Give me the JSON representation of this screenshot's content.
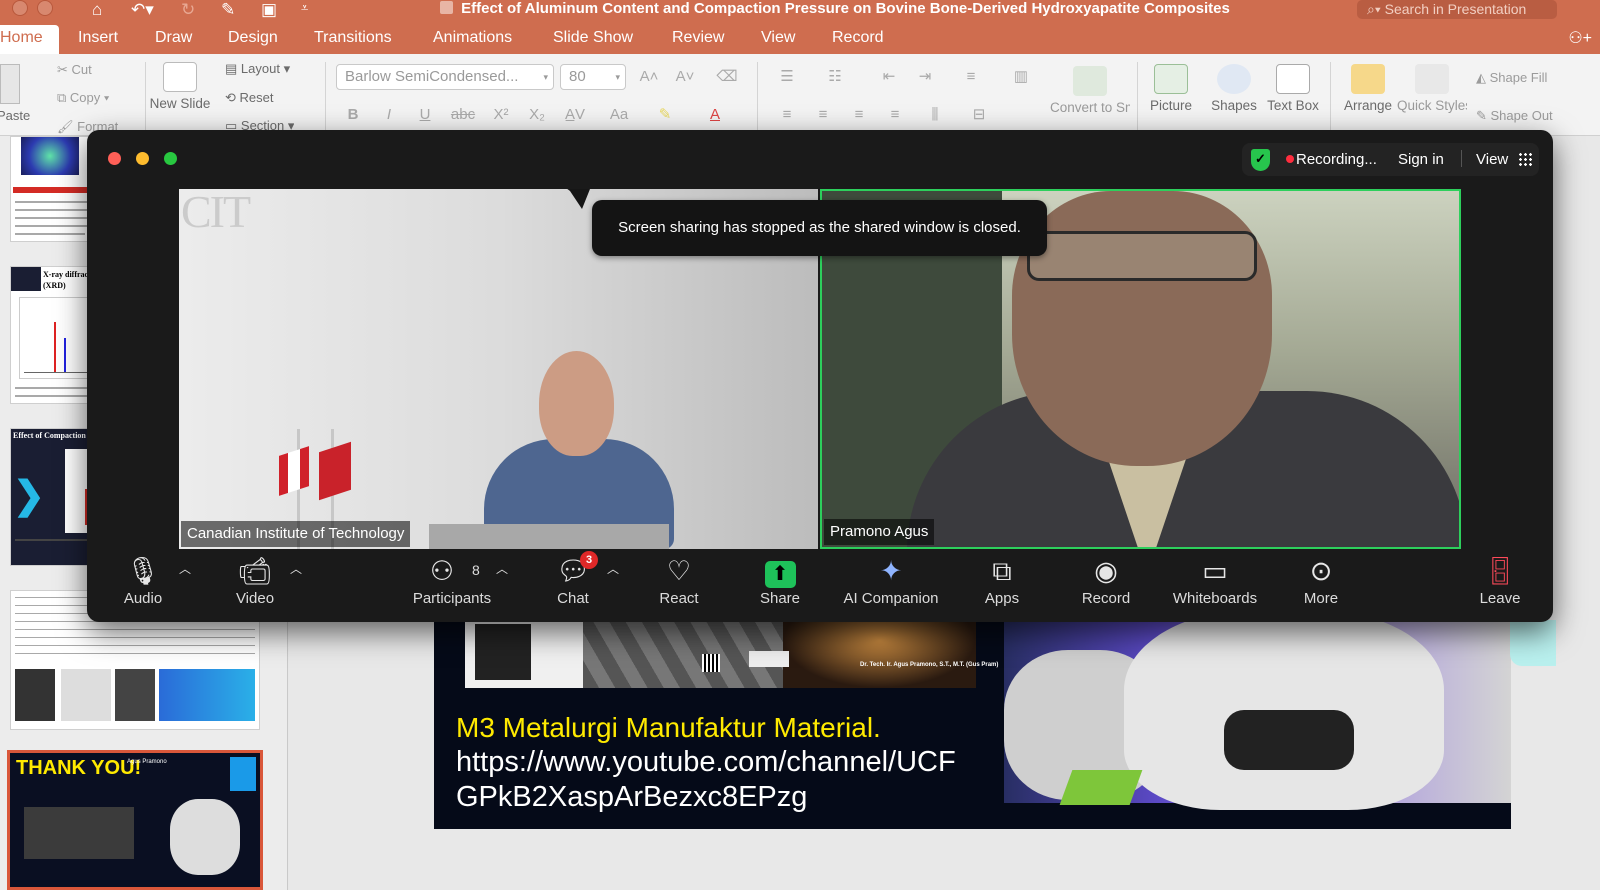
{
  "ppt": {
    "title": "Effect of Aluminum Content and Compaction Pressure on Bovine Bone-Derived Hydroxyapatite Composites",
    "search_placeholder": "Search in Presentation",
    "tabs": [
      "Home",
      "Insert",
      "Draw",
      "Design",
      "Transitions",
      "Animations",
      "Slide Show",
      "Review",
      "View",
      "Record"
    ],
    "ribbon": {
      "paste": "Paste",
      "cut": "Cut",
      "copy": "Copy",
      "format": "Format",
      "new_slide": "New\nSlide",
      "layout": "Layout",
      "reset": "Reset",
      "section": "Section",
      "font_name": "Barlow SemiCondensed...",
      "font_size": "80",
      "convert": "Convert to\nSmartArt",
      "picture": "Picture",
      "shapes": "Shapes",
      "text_box": "Text\nBox",
      "arrange": "Arrange",
      "quick_styles": "Quick\nStyles",
      "shape_fill": "Shape Fill",
      "shape_outline": "Shape Out"
    },
    "thumbs": {
      "t2_title": "X-ray diffraction\n(XRD)",
      "t3_title": "Effect of Compaction Pr",
      "t5_title": "THANK YOU!",
      "t5_name": "Agus Pramono"
    },
    "slide": {
      "line1": "M3 Metalurgi Manufaktur Material.",
      "line2": "https://www.youtube.com/channel/UCF",
      "line3": "GPkB2XaspArBezxc8EPzg",
      "sign": "Dr. Tech. Ir. Agus Pramono, S.T., M.T. (Gus Pram)"
    }
  },
  "zoom": {
    "recording": "Recording...",
    "sign_in": "Sign in",
    "view": "View",
    "toast": "Screen sharing has stopped as the shared window is closed.",
    "participants": [
      {
        "name": "Canadian Institute of Technology",
        "logo": "CIT"
      },
      {
        "name": "Pramono Agus"
      }
    ],
    "participant_count": "8",
    "chat_badge": "3",
    "toolbar": {
      "audio": "Audio",
      "video": "Video",
      "participants": "Participants",
      "chat": "Chat",
      "react": "React",
      "share": "Share",
      "ai": "AI Companion",
      "apps": "Apps",
      "record": "Record",
      "whiteboards": "Whiteboards",
      "more": "More",
      "leave": "Leave"
    },
    "colors": {
      "active_speaker": "#2dcf5c",
      "share": "#1ec25a",
      "record_dot": "#ff2d3e"
    }
  }
}
